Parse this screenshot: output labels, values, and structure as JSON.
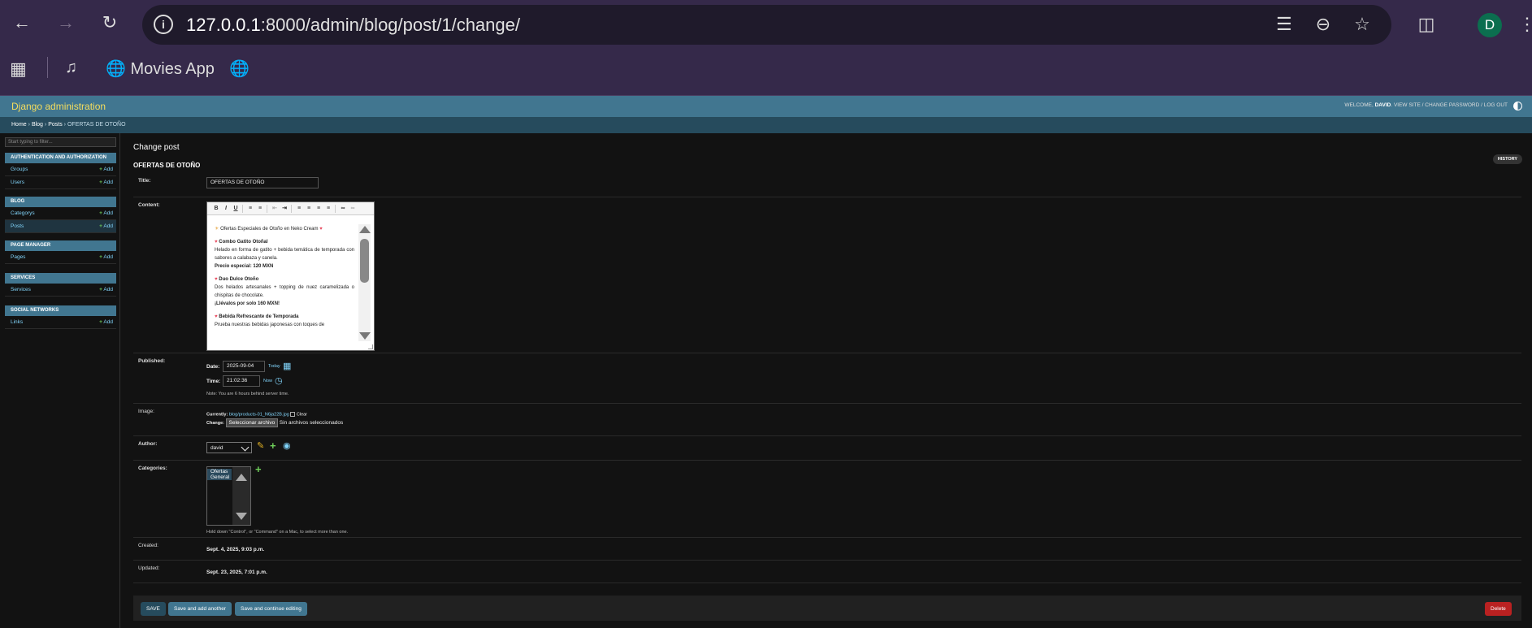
{
  "browser": {
    "url_host": "127.0.0.1",
    "url_path": ":8000/admin/blog/post/1/change/",
    "avatar_letter": "D",
    "bookmark_movies": "Movies App"
  },
  "header": {
    "brand": "Django administration",
    "welcome": "Welcome,",
    "user": "david",
    "view_site": "View site",
    "change_password": "Change password",
    "log_out": "Log out"
  },
  "breadcrumbs": {
    "home": "Home",
    "blog": "Blog",
    "posts": "Posts",
    "current": "OFERTAS DE OTOÑO",
    "sep": "›"
  },
  "sidebar": {
    "filter_placeholder": "Start typing to filter...",
    "add_label": "Add",
    "modules": [
      {
        "caption": "Authentication and Authorization",
        "items": [
          "Groups",
          "Users"
        ]
      },
      {
        "caption": "Blog",
        "items": [
          "Categorys",
          "Posts"
        ]
      },
      {
        "caption": "Page Manager",
        "items": [
          "Pages"
        ]
      },
      {
        "caption": "Services",
        "items": [
          "Services"
        ]
      },
      {
        "caption": "Social Networks",
        "items": [
          "Links"
        ]
      }
    ]
  },
  "page": {
    "title": "Change post",
    "object_name": "OFERTAS DE OTOÑO",
    "history": "History"
  },
  "form": {
    "title_label": "Title:",
    "title_value": "OFERTAS DE OTOÑO",
    "content_label": "Content:",
    "content": {
      "heading": "Ofertas Especiales de Otoño en Neko Cream",
      "items": [
        {
          "title": "Combo Gatito Otoñal",
          "text": "Helado en forma de gatito + bebida temática de temporada con sabores a calabaza y canela.",
          "price": "Precio especial: 120 MXN"
        },
        {
          "title": "Duo Dulce Otoño",
          "text": "Dos helados artesanales + topping de nuez caramelizada o chispitas de chocolate.",
          "price": "¡Llévalos por solo 160 MXN!"
        },
        {
          "title": "Bebida Refrescante de Temporada",
          "text": "Prueba nuestras bebidas japonesas con toques de",
          "price": ""
        }
      ]
    },
    "published_label": "Published:",
    "date_label": "Date:",
    "date_value": "2025-09-04",
    "today": "Today",
    "time_label": "Time:",
    "time_value": "21:02:36",
    "now": "Now",
    "tz_note": "Note: You are 6 hours behind server time.",
    "image_label": "Image:",
    "currently_label": "Currently:",
    "currently_file": "blog/products-01_N6ja22B.jpg",
    "clear_label": "Clear",
    "change_label": "Change:",
    "file_button": "Seleccionar archivo",
    "no_file": "Sin archivos seleccionados",
    "author_label": "Author:",
    "author_value": "david",
    "categories_label": "Categories:",
    "categories_options": [
      "Ofertas",
      "General"
    ],
    "categories_help": "Hold down \"Control\", or \"Command\" on a Mac, to select more than one.",
    "created_label": "Created:",
    "created_value": "Sept. 4, 2025, 9:03 p.m.",
    "updated_label": "Updated:",
    "updated_value": "Sept. 23, 2025, 7:01 p.m."
  },
  "actions": {
    "save": "SAVE",
    "save_add": "Save and add another",
    "save_continue": "Save and continue editing",
    "delete": "Delete"
  },
  "colors": {
    "header": "#417690",
    "breadcrumb": "#264b5d",
    "brand": "#f5dd5d",
    "link": "#81d4fa",
    "delete": "#ba2121",
    "chrome": "#35294a"
  }
}
